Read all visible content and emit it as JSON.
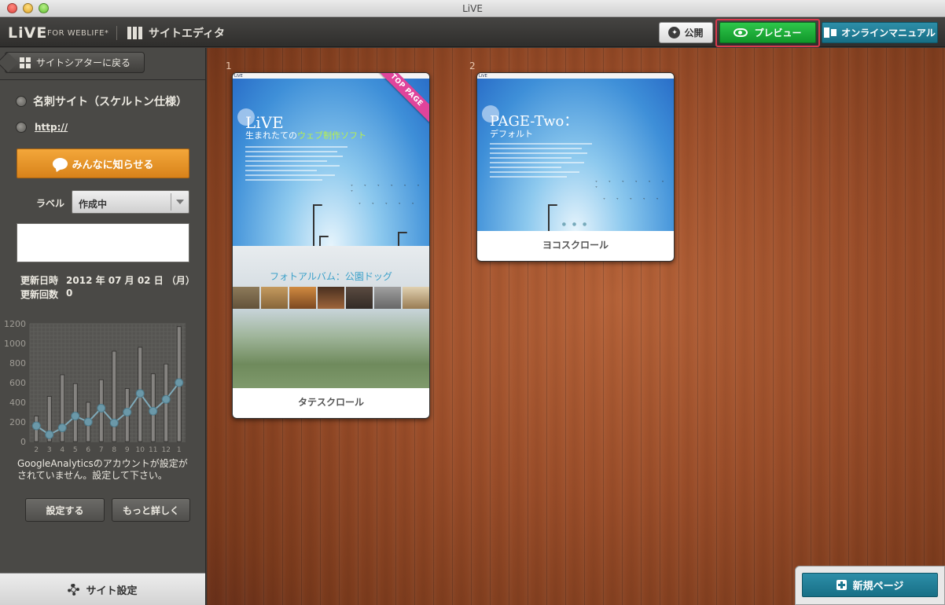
{
  "window": {
    "title": "LiVE"
  },
  "toolbar": {
    "logo": "LiVE",
    "logo_sub": "FOR WEBLIFE*",
    "editor_title": "サイトエディタ",
    "publish_label": "公開",
    "preview_label": "プレビュー",
    "manual_label": "オンラインマニュアル",
    "accent_preview": "#1aa83a",
    "accent_manual": "#1f7f98"
  },
  "sidebar": {
    "back_label": "サイトシアターに戻る",
    "site_name": "名刺サイト（スケルトン仕様）",
    "url": "http://",
    "share_label": "みんなに知らせる",
    "label_caption": "ラベル",
    "label_value": "作成中",
    "updated_caption": "更新日時",
    "updated_value": "2012 年 07 月 02 日 （月）",
    "count_caption": "更新回数",
    "count_value": "0",
    "ga_message": "GoogleAnalyticsのアカウントが設定がされていません。設定して下さい。",
    "setup_label": "設定する",
    "more_label": "もっと詳しく",
    "settings_label": "サイト設定"
  },
  "chart_data": {
    "type": "bar",
    "categories": [
      "2",
      "3",
      "4",
      "5",
      "6",
      "7",
      "8",
      "9",
      "10",
      "11",
      "12",
      "1"
    ],
    "series": [
      {
        "type": "bar",
        "values": [
          260,
          460,
          680,
          590,
          400,
          630,
          920,
          540,
          960,
          690,
          790,
          1170
        ]
      },
      {
        "type": "line",
        "values": [
          160,
          70,
          140,
          260,
          200,
          340,
          190,
          300,
          490,
          310,
          430,
          600
        ]
      }
    ],
    "yticks": [
      "0",
      "200",
      "400",
      "600",
      "800",
      "1000",
      "1200"
    ],
    "ylim": [
      0,
      1200
    ],
    "grid": true
  },
  "pages": [
    {
      "number": "1",
      "caption": "タテスクロール",
      "badge": "TOP PAGE",
      "thumb_title": "LiVE",
      "thumb_sub_prefix": "生まれたての",
      "thumb_sub_accent": "ウェブ制作ソフト",
      "thumb_album": "フォトアルバム：公園ドッグ"
    },
    {
      "number": "2",
      "caption": "ヨコスクロール",
      "thumb_title": "PAGE-Two：",
      "thumb_sub": "デフォルト"
    }
  ],
  "new_page_label": "新規ページ"
}
